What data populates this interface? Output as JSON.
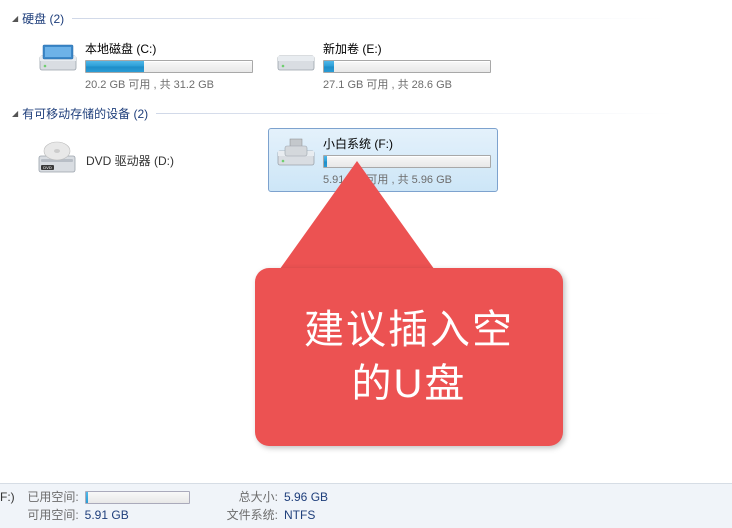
{
  "categories": {
    "hdd": {
      "label": "硬盘",
      "count": "(2)"
    },
    "removable": {
      "label": "有可移动存储的设备",
      "count": "(2)"
    }
  },
  "drives": {
    "c": {
      "name": "本地磁盘 (C:)",
      "stats": "20.2 GB 可用 , 共 31.2 GB",
      "fill_percent": 35
    },
    "e": {
      "name": "新加卷 (E:)",
      "stats": "27.1 GB 可用 , 共 28.6 GB",
      "fill_percent": 6
    },
    "dvd": {
      "name": "DVD 驱动器 (D:)"
    },
    "f": {
      "name": "小白系统 (F:)",
      "stats": "5.91 GB 可用 , 共 5.96 GB",
      "fill_percent": 2
    }
  },
  "callout": {
    "line1": "建议插入空",
    "line2": "的U盘"
  },
  "status": {
    "drive_label": "F:)",
    "used_label": "已用空间:",
    "free_label": "可用空间:",
    "free_value": "5.91 GB",
    "total_label": "总大小:",
    "total_value": "5.96 GB",
    "fs_label": "文件系统:",
    "fs_value": "NTFS"
  }
}
